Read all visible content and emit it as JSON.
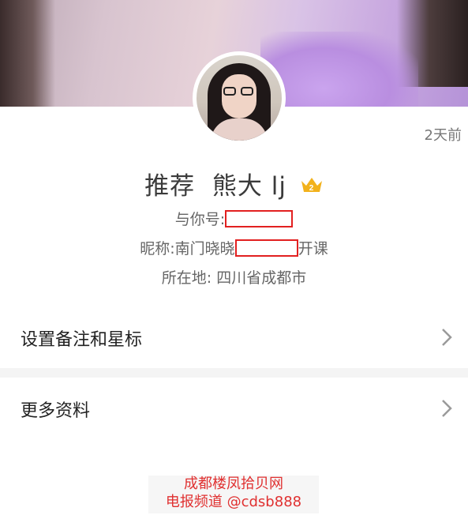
{
  "profile": {
    "time_ago": "2天前",
    "display_name": "推荐  熊大 lj",
    "crown_level": "2",
    "wechat_id_label": "与你号:",
    "nickname_prefix": "昵称:南门晓晓",
    "nickname_suffix": "开课",
    "region": "所在地: 四川省成都市"
  },
  "menu": {
    "remark_label": "设置备注和星标",
    "more_label": "更多资料"
  },
  "watermark": {
    "line1": "成都楼凤拾贝网",
    "line2": "电报频道 @cdsb888"
  },
  "colors": {
    "redaction": "#e22020",
    "watermark": "#e03030",
    "crown": "#f2b21c"
  },
  "icons": {
    "chevron": "chevron-right-icon",
    "crown": "crown-icon"
  }
}
